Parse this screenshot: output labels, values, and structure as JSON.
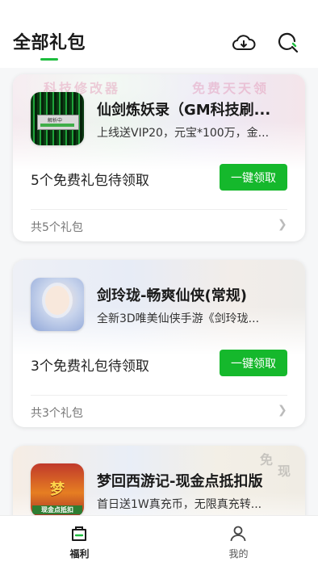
{
  "header": {
    "title": "全部礼包",
    "accent_color": "#1dbd3e",
    "icons": [
      "cloud-download-icon",
      "search-icon"
    ]
  },
  "cards": [
    {
      "banner": [
        "科技修改器",
        "免费天天领"
      ],
      "thumb_dialog": "解析中",
      "name": "仙剑炼妖录（GM科技刷...",
      "desc": "上线送VIP20，元宝*100万，金...",
      "pending": "5个免费礼包待领取",
      "button": "一键领取",
      "count": "共5个礼包"
    },
    {
      "name": "剑玲珑-畅爽仙侠(常规)",
      "desc": "全新3D唯美仙侠手游《剑玲珑...",
      "pending": "3个免费礼包待领取",
      "button": "一键领取",
      "count": "共3个礼包"
    },
    {
      "banner": [
        "免",
        "现"
      ],
      "thumb_title": "梦",
      "thumb_sub": "现金点抵扣",
      "name": "梦回西游记-现金点抵扣版",
      "desc": "首日送1W真充币，无限真充转..."
    }
  ],
  "tabbar": {
    "tabs": [
      {
        "label": "福利",
        "icon": "gift-bag-icon",
        "active": true
      },
      {
        "label": "我的",
        "icon": "user-icon",
        "active": false
      }
    ]
  },
  "colors": {
    "button_green": "#15b82c",
    "background": "#f6f7f8"
  }
}
